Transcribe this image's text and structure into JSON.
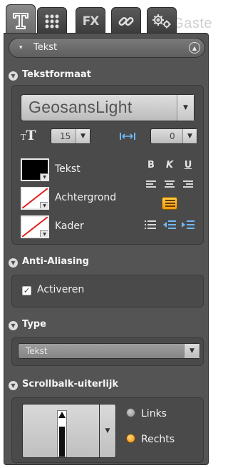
{
  "background": {
    "text": "Gaste"
  },
  "tabs": [
    {
      "name": "text-tab",
      "icon": "text-icon",
      "active": true
    },
    {
      "name": "grid-tab",
      "icon": "grid-icon",
      "active": false
    },
    {
      "name": "fx-tab",
      "label": "FX",
      "active": false
    },
    {
      "name": "link-tab",
      "icon": "link-icon",
      "active": false
    },
    {
      "name": "settings-tab",
      "icon": "gears-icon",
      "active": false
    }
  ],
  "panel": {
    "header": {
      "caret": "▾",
      "title": "Tekst"
    },
    "textformat": {
      "title": "Tekstformaat",
      "font": "GeosansLight",
      "size": "15",
      "spacing": "0",
      "color_labels": [
        "Tekst",
        "Achtergrond",
        "Kader"
      ],
      "bold": "B",
      "italic": "K",
      "underline": "U"
    },
    "antialiasing": {
      "title": "Anti-Aliasing",
      "checkbox_label": "Activeren",
      "checked": true
    },
    "type": {
      "title": "Type",
      "selected": "Tekst"
    },
    "scrollbar": {
      "title": "Scrollbalk-uiterlijk",
      "options": [
        "Links",
        "Rechts"
      ],
      "selected": "Rechts"
    }
  },
  "colors": {
    "panel": "#545454",
    "accent": "#f0a020",
    "swatch_text": "#000000"
  }
}
